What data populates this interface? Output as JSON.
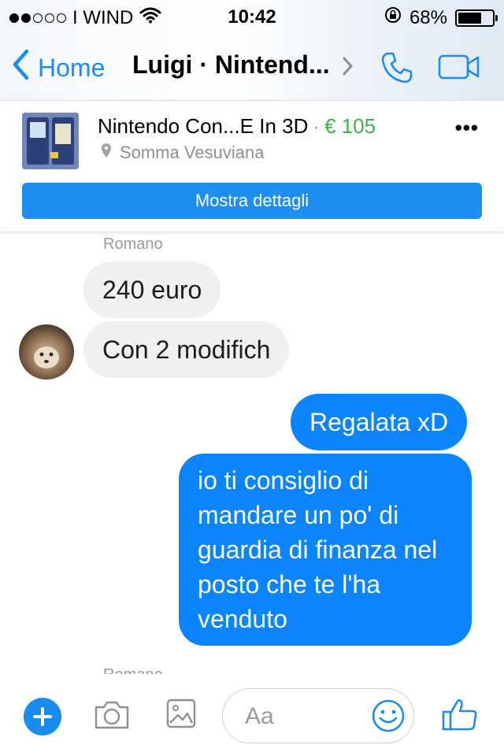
{
  "status_bar": {
    "carrier": "I WIND",
    "time": "10:42",
    "battery_pct": "68%",
    "battery_level": 0.68,
    "signal_bars_filled": 2,
    "signal_bars_total": 5
  },
  "nav": {
    "back_label": "Home",
    "title": "Luigi · Nintend..."
  },
  "product": {
    "title": "Nintendo  Con...E In 3D",
    "separator": "·",
    "price": "€ 105",
    "location": "Somma Vesuviana",
    "details_button": "Mostra dettagli"
  },
  "messages": {
    "sender_name": "Romano",
    "incoming": [
      "240 euro",
      "Con 2 modifich"
    ],
    "outgoing": [
      "Regalata xD",
      "io ti consiglio di mandare un po' di guardia di finanza nel posto che te l'ha venduto"
    ],
    "next_sender_name": "Romano"
  },
  "composer": {
    "placeholder": "Aa"
  },
  "colors": {
    "accent": "#1a8cf0",
    "outgoing_bubble": "#0a84ff",
    "incoming_bubble": "#f1f0f0",
    "price": "#3fb24b",
    "details_button": "#1f8ef1"
  },
  "icons": [
    "phone-icon",
    "video-camera-icon",
    "back-chevron-icon",
    "chevron-right-icon",
    "location-pin-icon",
    "more-icon",
    "plus-icon",
    "camera-icon",
    "image-icon",
    "emoji-icon",
    "thumbs-up-icon",
    "wifi-icon",
    "lock-rotation-icon",
    "battery-icon"
  ]
}
